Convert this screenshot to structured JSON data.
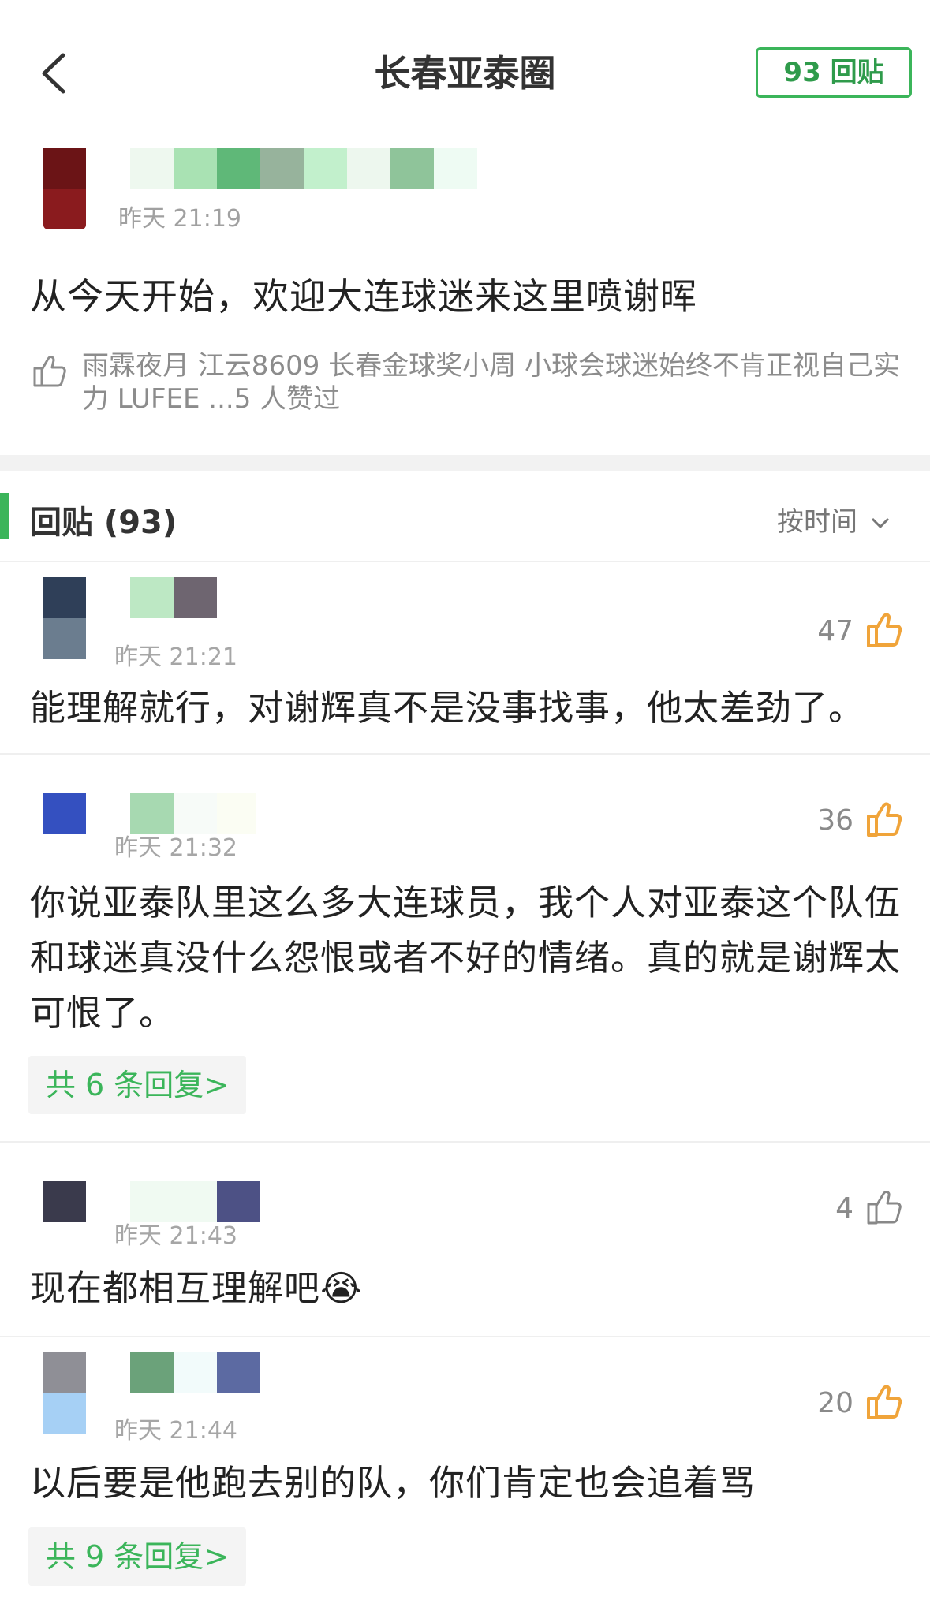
{
  "header": {
    "title": "长春亚泰圈",
    "reply_button": "93 回贴"
  },
  "post": {
    "time": "昨天 21:19",
    "text": "从今天开始，欢迎大连球迷来这里喷谢晖",
    "likers": "雨霖夜月 江云8609 长春金球奖小周 小球会球迷始终不肯正视自己实力 LUFEE ...5 人赞过"
  },
  "replies_section": {
    "heading": "回贴 (93)",
    "sort": "按时间"
  },
  "comments": [
    {
      "time": "昨天 21:21",
      "likes": "47",
      "text": "能理解就行，对谢辉真不是没事找事，他太差劲了。"
    },
    {
      "time": "昨天 21:32",
      "likes": "36",
      "text": "你说亚泰队里这么多大连球员，我个人对亚泰这个队伍和球迷真没什么怨恨或者不好的情绪。真的就是谢辉太可恨了。",
      "sub_replies": "共 6 条回复>"
    },
    {
      "time": "昨天 21:43",
      "likes": "4",
      "text": "现在都相互理解吧😭"
    },
    {
      "time": "昨天 21:44",
      "likes": "20",
      "text": "以后要是他跑去别的队，你们肯定也会追着骂",
      "sub_replies": "共 9 条回复>"
    }
  ],
  "colors": {
    "accent": "#3bb55a",
    "like_active": "#f0a43a",
    "like_inactive": "#888888"
  }
}
